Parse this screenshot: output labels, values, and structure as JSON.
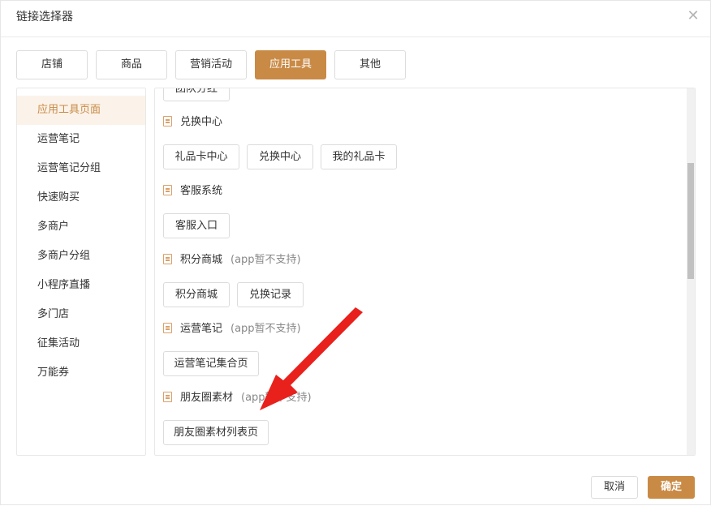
{
  "dialog": {
    "title": "链接选择器"
  },
  "tabs": [
    {
      "label": "店铺"
    },
    {
      "label": "商品"
    },
    {
      "label": "营销活动"
    },
    {
      "label": "应用工具"
    },
    {
      "label": "其他"
    }
  ],
  "active_tab": "应用工具",
  "sidebar": {
    "items": [
      {
        "label": "应用工具页面"
      },
      {
        "label": "运营笔记"
      },
      {
        "label": "运营笔记分组"
      },
      {
        "label": "快速购买"
      },
      {
        "label": "多商户"
      },
      {
        "label": "多商户分组"
      },
      {
        "label": "小程序直播"
      },
      {
        "label": "多门店"
      },
      {
        "label": "征集活动"
      },
      {
        "label": "万能券"
      }
    ],
    "active": "应用工具页面"
  },
  "content": {
    "partial_top_button": "团队分红",
    "sections": [
      {
        "title": "兑换中心",
        "note": "",
        "buttons": [
          "礼品卡中心",
          "兑换中心",
          "我的礼品卡"
        ]
      },
      {
        "title": "客服系统",
        "note": "",
        "buttons": [
          "客服入口"
        ]
      },
      {
        "title": "积分商城",
        "note": "(app暂不支持)",
        "buttons": [
          "积分商城",
          "兑换记录"
        ]
      },
      {
        "title": "运营笔记",
        "note": "(app暂不支持)",
        "buttons": [
          "运营笔记集合页"
        ]
      },
      {
        "title": "朋友圈素材",
        "note": "(app暂不支持)",
        "buttons": [
          "朋友圈素材列表页"
        ]
      }
    ]
  },
  "footer": {
    "cancel_label": "取消",
    "ok_label": "确定"
  },
  "colors": {
    "accent": "#c98a45",
    "annotation_arrow": "#e8211d"
  }
}
